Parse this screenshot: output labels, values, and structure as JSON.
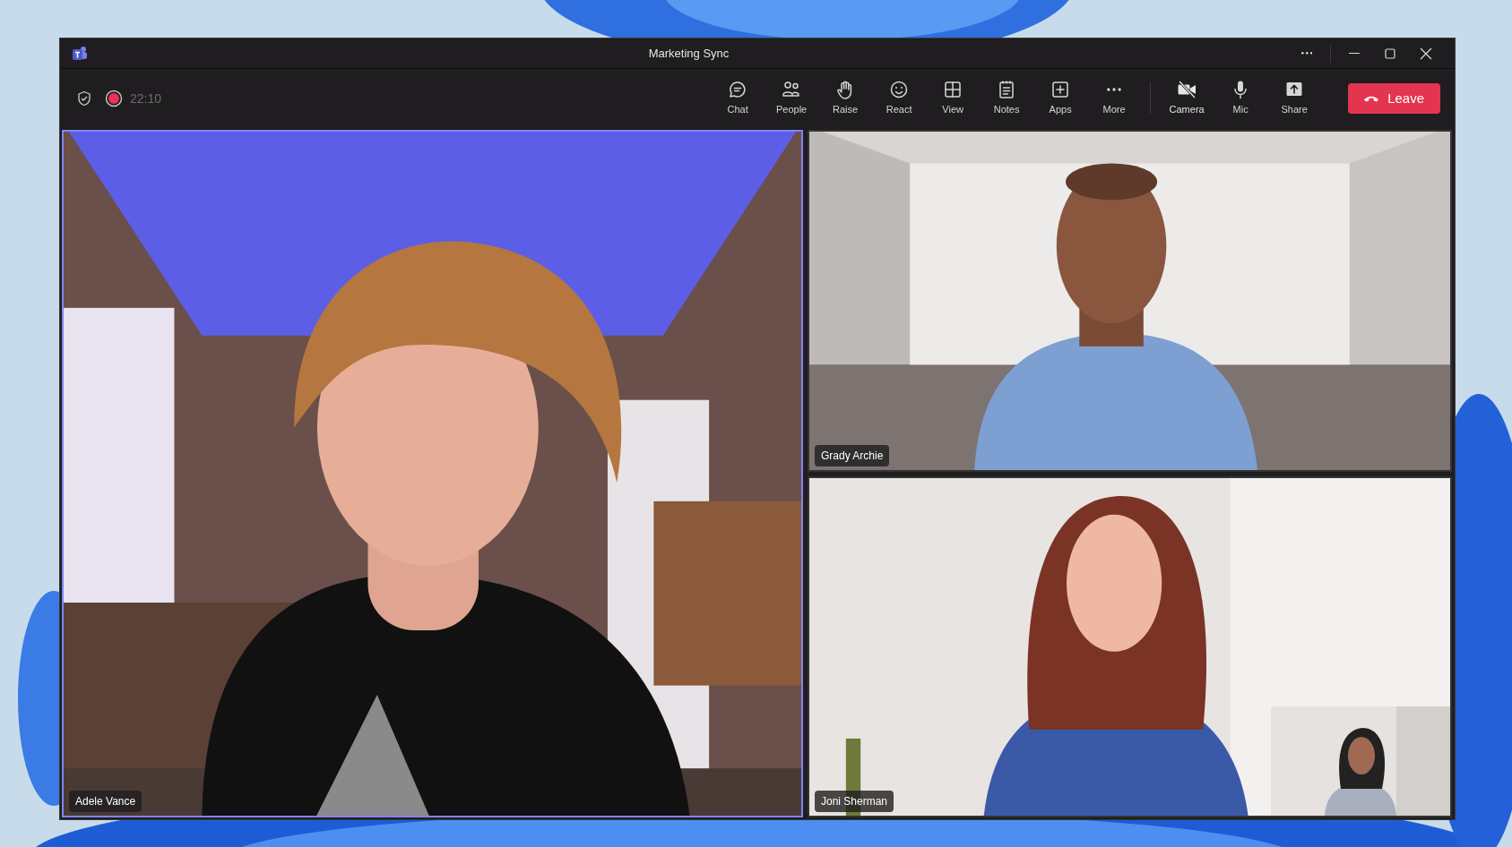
{
  "window": {
    "title": "Marketing Sync"
  },
  "meeting": {
    "recording": true,
    "duration": "22:10"
  },
  "toolbar": [
    {
      "label": "Chat",
      "kind": "chat"
    },
    {
      "label": "People",
      "kind": "people"
    },
    {
      "label": "Raise",
      "kind": "raise"
    },
    {
      "label": "React",
      "kind": "react"
    },
    {
      "label": "View",
      "kind": "view"
    },
    {
      "label": "Notes",
      "kind": "notes"
    },
    {
      "label": "Apps",
      "kind": "apps"
    },
    {
      "label": "More",
      "kind": "more"
    }
  ],
  "device_controls": [
    {
      "label": "Camera",
      "kind": "camera",
      "on": false
    },
    {
      "label": "Mic",
      "kind": "mic",
      "on": true
    }
  ],
  "share_button": {
    "label": "Share"
  },
  "leave_button": {
    "label": "Leave"
  },
  "participants": [
    {
      "name": "Adele Vance",
      "active_speaker": true,
      "kind": "picture"
    },
    {
      "name": "Grady Archie",
      "active_speaker": false,
      "kind": "picture"
    },
    {
      "name": "Joni Sherman",
      "active_speaker": false,
      "kind": "picture"
    }
  ]
}
